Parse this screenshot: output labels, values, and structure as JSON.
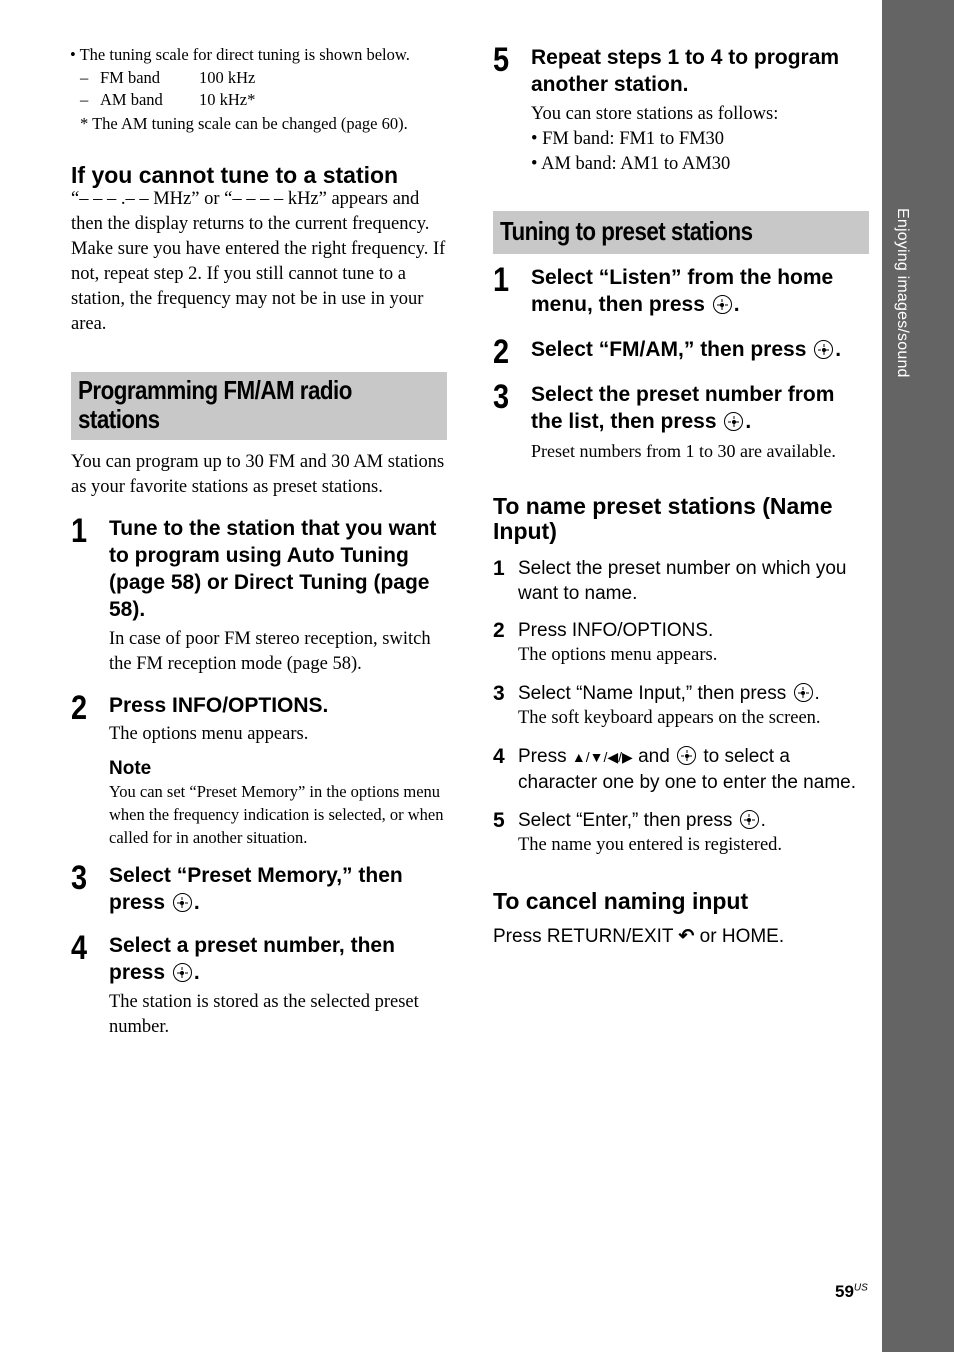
{
  "side_tab": {
    "label": "Enjoying images/sound"
  },
  "page_number": {
    "number": "59",
    "suffix": "US"
  },
  "left": {
    "tuning_scale": {
      "intro": "• The tuning scale for direct tuning is shown below.",
      "rows": [
        {
          "dash": "–",
          "band": "FM band",
          "value": "100 kHz"
        },
        {
          "dash": "–",
          "band": "AM band",
          "value": "10 kHz*"
        }
      ],
      "footnote": "* The AM tuning scale can be changed (page 60)."
    },
    "cannot_tune": {
      "heading": "If you cannot tune to a station",
      "p1": "“– – – .– – MHz” or “– – – – kHz” appears and then the display returns to the current frequency.",
      "p2": "Make sure you have entered the right frequency. If not, repeat step 2. If you still cannot tune to a station, the frequency may not be in use in your area."
    },
    "programming": {
      "banner_line1": "Programming FM/AM radio",
      "banner_line2": "stations",
      "intro": "You can program up to 30 FM and 30 AM stations as your favorite stations as preset stations.",
      "steps": [
        {
          "num": "1",
          "title": "Tune to the station that you want to program using Auto Tuning (page 58) or Direct Tuning (page 58).",
          "body": "In case of poor FM stereo reception, switch the FM reception mode (page 58)."
        },
        {
          "num": "2",
          "title": "Press INFO/OPTIONS.",
          "body": "The options menu appears."
        },
        {
          "num": "3",
          "title_pre": "Select “Preset Memory,” then press",
          "title_post": "."
        },
        {
          "num": "4",
          "title_pre": "Select a preset number, then press",
          "title_post": ".",
          "body": "The station is stored as the selected preset number."
        }
      ],
      "note": {
        "label": "Note",
        "text": "You can set “Preset Memory” in the options menu when the frequency indication is selected, or when called for in another situation."
      }
    }
  },
  "right": {
    "step5": {
      "num": "5",
      "title": "Repeat steps 1 to 4 to program another station.",
      "body": "You can store stations as follows:",
      "bullets": [
        "• FM band: FM1 to FM30",
        "• AM band: AM1 to AM30"
      ]
    },
    "preset": {
      "banner": "Tuning to preset stations",
      "steps": [
        {
          "num": "1",
          "title_pre": "Select “Listen” from the home menu, then press",
          "title_post": "."
        },
        {
          "num": "2",
          "title_pre": "Select “FM/AM,” then press",
          "title_post": "."
        },
        {
          "num": "3",
          "title_pre": "Select the preset number from the list, then press",
          "title_post": ".",
          "body": "Preset numbers from 1 to 30 are available."
        }
      ]
    },
    "name_input": {
      "heading": "To name preset stations (Name Input)",
      "steps": [
        {
          "num": "1",
          "text": "Select the preset number on which you want to name."
        },
        {
          "num": "2",
          "text": "Press INFO/OPTIONS.",
          "body": "The options menu appears."
        },
        {
          "num": "3",
          "text_pre": "Select “Name Input,” then press",
          "text_post": ".",
          "body": "The soft keyboard appears on the screen."
        },
        {
          "num": "4",
          "text_pre": "Press",
          "arrows": "▲/▼/◀/▶",
          "text_mid": "and",
          "text_post": "to select a character one by one to enter the name."
        },
        {
          "num": "5",
          "text_pre": "Select “Enter,” then press",
          "text_post": ".",
          "body": "The name you entered is registered."
        }
      ]
    },
    "cancel": {
      "heading": "To cancel naming input",
      "text_pre": "Press RETURN/EXIT",
      "return_glyph": "↶",
      "text_post": "or HOME."
    }
  }
}
